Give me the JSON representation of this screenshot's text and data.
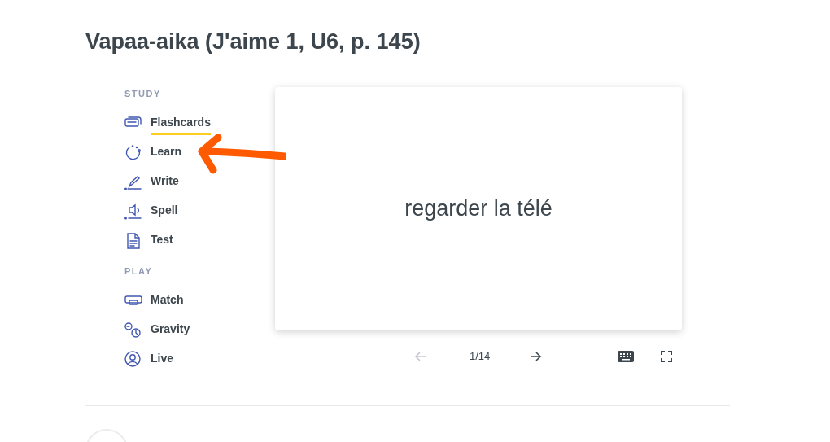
{
  "title": "Vapaa-aika (J'aime 1, U6, p. 145)",
  "sections": [
    {
      "heading": "STUDY",
      "items": [
        {
          "kind": "flashcards",
          "label": "Flashcards",
          "selected": true
        },
        {
          "kind": "learn",
          "label": "Learn",
          "selected": false
        },
        {
          "kind": "write",
          "label": "Write",
          "selected": false
        },
        {
          "kind": "spell",
          "label": "Spell",
          "selected": false
        },
        {
          "kind": "test",
          "label": "Test",
          "selected": false
        }
      ]
    },
    {
      "heading": "PLAY",
      "items": [
        {
          "kind": "match",
          "label": "Match",
          "selected": false
        },
        {
          "kind": "gravity",
          "label": "Gravity",
          "selected": false
        },
        {
          "kind": "live",
          "label": "Live",
          "selected": false
        }
      ]
    }
  ],
  "card": {
    "term": "regarder la télé"
  },
  "controls": {
    "previous_disabled": true,
    "counter": "1/14"
  }
}
